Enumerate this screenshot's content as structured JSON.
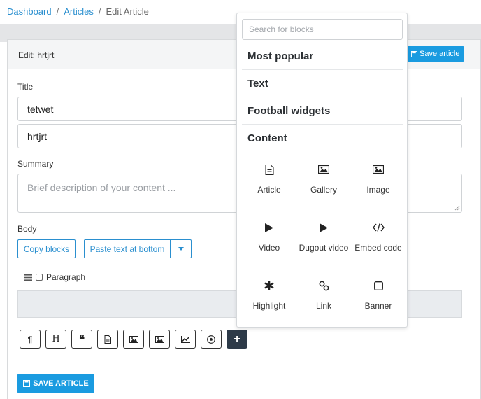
{
  "breadcrumb": {
    "home": "Dashboard",
    "section": "Articles",
    "current": "Edit Article",
    "sep": "/"
  },
  "header": {
    "title": "Edit: hrtjrt",
    "save_label": "Save article"
  },
  "form": {
    "title_label": "Title",
    "title_value": "tetwet",
    "second_value": "hrtjrt",
    "summary_label": "Summary",
    "summary_placeholder": "Brief description of your content ...",
    "body_label": "Body",
    "copy_blocks": "Copy blocks",
    "paste_text": "Paste text at bottom",
    "paragraph_label": "Paragraph"
  },
  "toolbar": {
    "buttons": [
      {
        "name": "paragraph",
        "glyph": "¶"
      },
      {
        "name": "heading",
        "glyph": "H"
      },
      {
        "name": "quote",
        "glyph": "❝"
      },
      {
        "name": "article",
        "glyph": "document"
      },
      {
        "name": "gallery",
        "glyph": "image"
      },
      {
        "name": "image",
        "glyph": "image"
      },
      {
        "name": "chart",
        "glyph": "chart"
      },
      {
        "name": "football",
        "glyph": "ball"
      },
      {
        "name": "add",
        "glyph": "+"
      }
    ]
  },
  "save_bottom_label": "SAVE ARTICLE",
  "popup": {
    "search_placeholder": "Search for blocks",
    "categories": [
      "Most popular",
      "Text",
      "Football widgets",
      "Content"
    ],
    "blocks": [
      {
        "label": "Article",
        "icon": "document-icon"
      },
      {
        "label": "Gallery",
        "icon": "gallery-icon"
      },
      {
        "label": "Image",
        "icon": "image-icon"
      },
      {
        "label": "Video",
        "icon": "play-icon"
      },
      {
        "label": "Dugout video",
        "icon": "play-icon"
      },
      {
        "label": "Embed code",
        "icon": "code-icon"
      },
      {
        "label": "Highlight",
        "icon": "asterisk-icon"
      },
      {
        "label": "Link",
        "icon": "link-icon"
      },
      {
        "label": "Banner",
        "icon": "square-icon"
      }
    ]
  },
  "colors": {
    "primary": "#1a9be0",
    "link": "#2a8fcf",
    "dark_button": "#2d3a48"
  }
}
